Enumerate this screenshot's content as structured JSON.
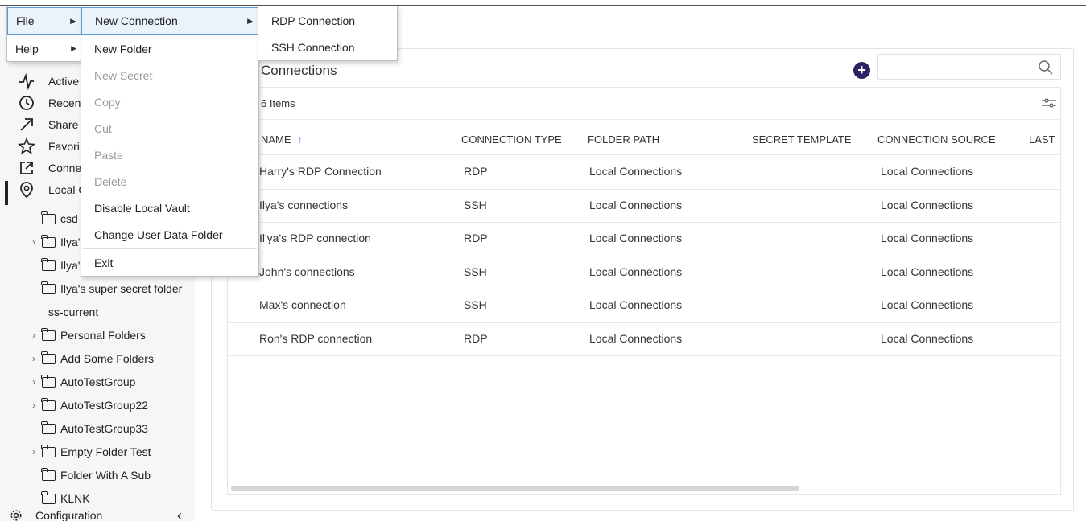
{
  "menubar": {
    "file": "File",
    "help": "Help"
  },
  "file_menu": {
    "items": [
      {
        "label": "New Connection",
        "disabled": false
      },
      {
        "label": "New Folder",
        "disabled": false
      },
      {
        "label": "New Secret",
        "disabled": true
      },
      {
        "label": "Copy",
        "disabled": true
      },
      {
        "label": "Cut",
        "disabled": true
      },
      {
        "label": "Paste",
        "disabled": true
      },
      {
        "label": "Delete",
        "disabled": true
      },
      {
        "label": "Disable Local Vault",
        "disabled": false
      },
      {
        "label": "Change User Data Folder",
        "disabled": false
      },
      {
        "label": "Exit",
        "disabled": false
      }
    ]
  },
  "new_connection_menu": {
    "items": [
      "RDP Connection",
      "SSH Connection"
    ]
  },
  "sidebar": {
    "nav": [
      {
        "label": "Active",
        "icon": "activity-icon"
      },
      {
        "label": "Recen",
        "icon": "clock-icon"
      },
      {
        "label": "Share",
        "icon": "share-arrow-icon"
      },
      {
        "label": "Favori",
        "icon": "star-icon"
      },
      {
        "label": "Conne",
        "icon": "external-link-icon"
      },
      {
        "label": "Local C",
        "icon": "location-pin-icon"
      }
    ],
    "tree": [
      {
        "label": "csd",
        "chevron": false
      },
      {
        "label": "Ilya'",
        "chevron": true
      },
      {
        "label": "Ilya'",
        "chevron": false
      },
      {
        "label": "Ilya's super secret folder",
        "chevron": false
      },
      {
        "label": "ss-current",
        "chevron": false,
        "noFolder": true
      },
      {
        "label": "Personal Folders",
        "chevron": true
      },
      {
        "label": "Add Some Folders",
        "chevron": true
      },
      {
        "label": "AutoTestGroup",
        "chevron": true
      },
      {
        "label": "AutoTestGroup22",
        "chevron": true
      },
      {
        "label": "AutoTestGroup33",
        "chevron": false
      },
      {
        "label": "Empty Folder Test",
        "chevron": true
      },
      {
        "label": "Folder With A Sub",
        "chevron": false
      },
      {
        "label": "KLNK",
        "chevron": false
      }
    ],
    "configuration": "Configuration"
  },
  "main": {
    "title": "Connections",
    "items_count": "6 Items",
    "columns": [
      "NAME",
      "CONNECTION TYPE",
      "FOLDER PATH",
      "SECRET TEMPLATE",
      "CONNECTION SOURCE",
      "LAST"
    ],
    "sort_indicator": "↑",
    "rows": [
      [
        "Harry's RDP Connection",
        "RDP",
        "Local Connections",
        "",
        "Local Connections"
      ],
      [
        "Ilya's connections",
        "SSH",
        "Local Connections",
        "",
        "Local Connections"
      ],
      [
        "Il'ya's RDP connection",
        "RDP",
        "Local Connections",
        "",
        "Local Connections"
      ],
      [
        "John's connections",
        "SSH",
        "Local Connections",
        "",
        "Local Connections"
      ],
      [
        "Max's connection",
        "SSH",
        "Local Connections",
        "",
        "Local Connections"
      ],
      [
        "Ron's RDP connection",
        "RDP",
        "Local Connections",
        "",
        "Local Connections"
      ]
    ]
  },
  "colors": {
    "accent": "#2a2466",
    "sort_arrow": "#7b6fd6",
    "menu_active_border": "#5b9bd5"
  }
}
